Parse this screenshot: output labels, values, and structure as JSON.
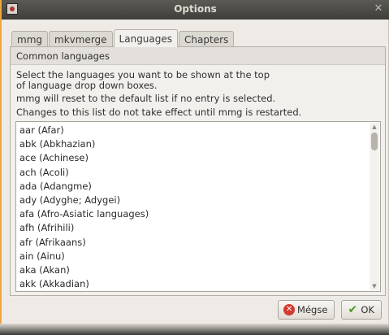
{
  "window": {
    "title": "Options"
  },
  "tabs": [
    {
      "label": "mmg",
      "active": false
    },
    {
      "label": "mkvmerge",
      "active": false
    },
    {
      "label": "Languages",
      "active": true
    },
    {
      "label": "Chapters",
      "active": false
    }
  ],
  "group": {
    "title": "Common languages",
    "description_line1": "Select the languages you want to be shown at the top",
    "description_line2": "of language drop down boxes.",
    "reset_note": "mmg will reset to the default list if no entry is selected.",
    "restart_note": "Changes to this list do not take effect until mmg is restarted."
  },
  "languages": [
    "aar (Afar)",
    "abk (Abkhazian)",
    "ace (Achinese)",
    "ach (Acoli)",
    "ada (Adangme)",
    "ady (Adyghe; Adygei)",
    "afa (Afro-Asiatic languages)",
    "afh (Afrihili)",
    "afr (Afrikaans)",
    "ain (Ainu)",
    "aka (Akan)",
    "akk (Akkadian)"
  ],
  "buttons": {
    "cancel_label": "Mégse",
    "ok_label": "OK"
  },
  "colors": {
    "window_accent": "#f0a640",
    "titlebar": "#4a4945"
  }
}
